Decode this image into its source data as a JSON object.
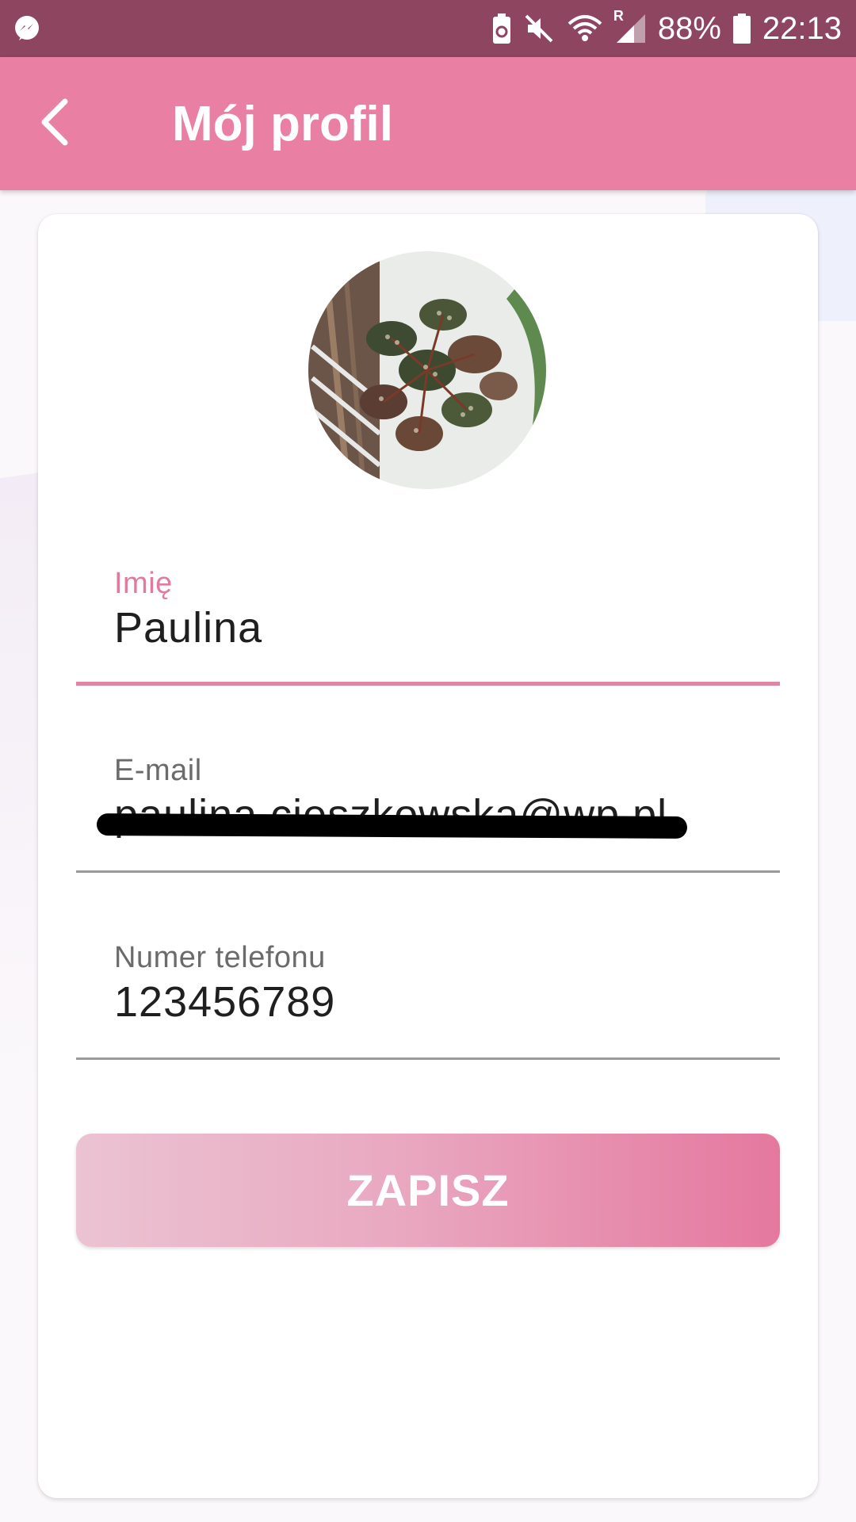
{
  "status_bar": {
    "battery_percent": "88%",
    "time": "22:13",
    "roaming_indicator": "R",
    "icons": [
      "messenger-icon",
      "battery-saver-icon",
      "mute-icon",
      "wifi-icon",
      "signal-icon",
      "battery-icon"
    ]
  },
  "app_bar": {
    "title": "Mój profil",
    "back_icon": "chevron-left-icon"
  },
  "profile": {
    "avatar_description": "potted plant photo"
  },
  "form": {
    "name": {
      "label": "Imię",
      "value": "Paulina"
    },
    "email": {
      "label": "E-mail",
      "value": "paulina.cieszkowska@wp.pl"
    },
    "phone": {
      "label": "Numer telefonu",
      "value": "123456789"
    },
    "save_label": "ZAPISZ"
  },
  "colors": {
    "status_bar": "#8e4560",
    "app_bar": "#e97fa3",
    "accent": "#e27aa0",
    "button_start": "#ebc3d2",
    "button_end": "#e5789e"
  }
}
